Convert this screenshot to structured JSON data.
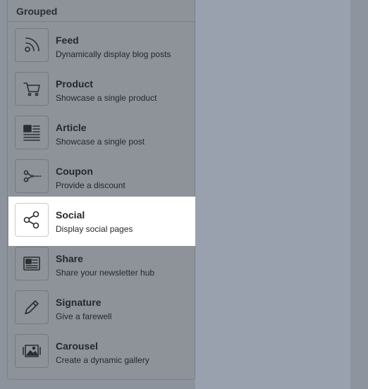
{
  "panel": {
    "header": "Grouped",
    "items": [
      {
        "title": "Feed",
        "desc": "Dynamically display blog posts",
        "icon": "rss-feed-icon"
      },
      {
        "title": "Product",
        "desc": "Showcase a single product",
        "icon": "shopping-cart-icon"
      },
      {
        "title": "Article",
        "desc": "Showcase a single post",
        "icon": "article-icon"
      },
      {
        "title": "Coupon",
        "desc": "Provide a discount",
        "icon": "scissors-icon"
      },
      {
        "title": "Social",
        "desc": "Display social pages",
        "icon": "share-nodes-icon",
        "active": true
      },
      {
        "title": "Share",
        "desc": "Share your newsletter hub",
        "icon": "newspaper-icon"
      },
      {
        "title": "Signature",
        "desc": "Give a farewell",
        "icon": "pencil-icon"
      },
      {
        "title": "Carousel",
        "desc": "Create a dynamic gallery",
        "icon": "image-gallery-icon"
      }
    ]
  }
}
